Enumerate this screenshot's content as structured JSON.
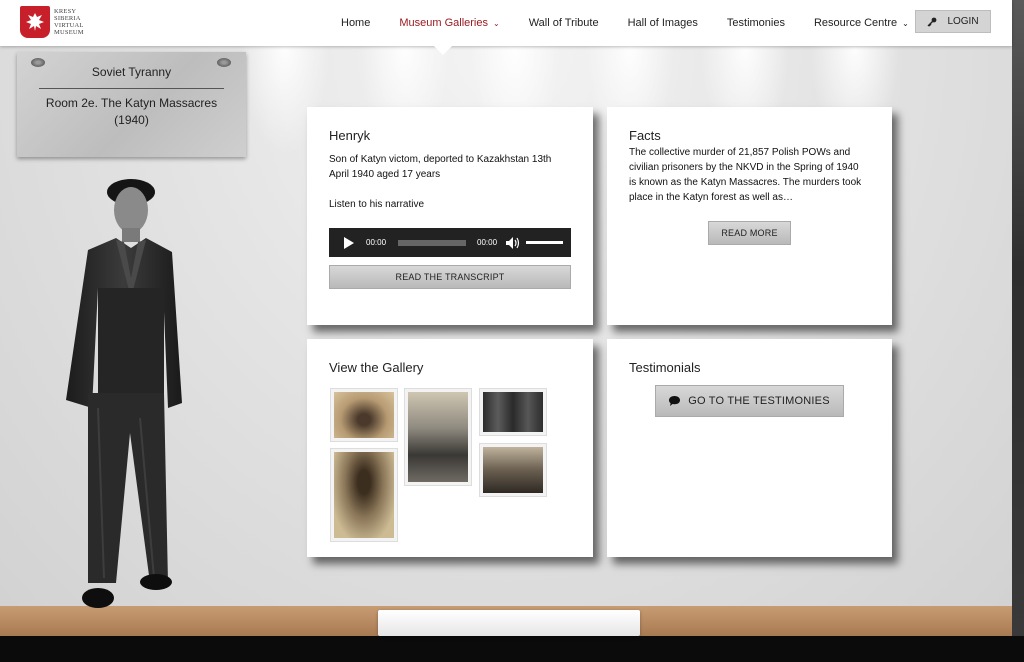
{
  "header": {
    "logo_lines": [
      "KRESY",
      "SIBERIA",
      "VIRTUAL",
      "MUSEUM"
    ],
    "nav": [
      {
        "label": "Home",
        "dropdown": false,
        "active": false
      },
      {
        "label": "Museum Galleries",
        "dropdown": true,
        "active": true
      },
      {
        "label": "Wall of Tribute",
        "dropdown": false,
        "active": false
      },
      {
        "label": "Hall of Images",
        "dropdown": false,
        "active": false
      },
      {
        "label": "Testimonies",
        "dropdown": false,
        "active": false
      },
      {
        "label": "Resource Centre",
        "dropdown": true,
        "active": false
      }
    ],
    "login_label": "LOGIN",
    "login_icon": "key-icon"
  },
  "plaque": {
    "title": "Soviet Tyranny",
    "room_line1": "Room 2e. The Katyn Massacres",
    "room_line2": "(1940)"
  },
  "cards": {
    "henryk": {
      "title": "Henryk",
      "line1": "Son of Katyn victom, deported to Kazakhstan 13th",
      "line2": "April 1940 aged 17 years",
      "listen": "Listen to his narrative",
      "audio_current": "00:00",
      "audio_duration": "00:00",
      "transcript_button": "READ THE TRANSCRIPT"
    },
    "facts": {
      "title": "Facts",
      "line1": "The collective murder of 21,857 Polish POWs and",
      "line2": "civilian prisoners by the NKVD in the Spring of 1940",
      "line3": "is known as the Katyn Massacres.  The murders took",
      "line4": "place in the Katyn forest as well as…",
      "read_more": "READ MORE"
    },
    "gallery": {
      "title": "View the Gallery"
    },
    "testimonials": {
      "title": "Testimonials",
      "button": "GO TO THE TESTIMONIES",
      "button_icon": "speech-bubble-icon"
    }
  },
  "colors": {
    "accent": "#9a1b22",
    "audio_bg": "#222222",
    "card_bg": "#ffffff"
  }
}
